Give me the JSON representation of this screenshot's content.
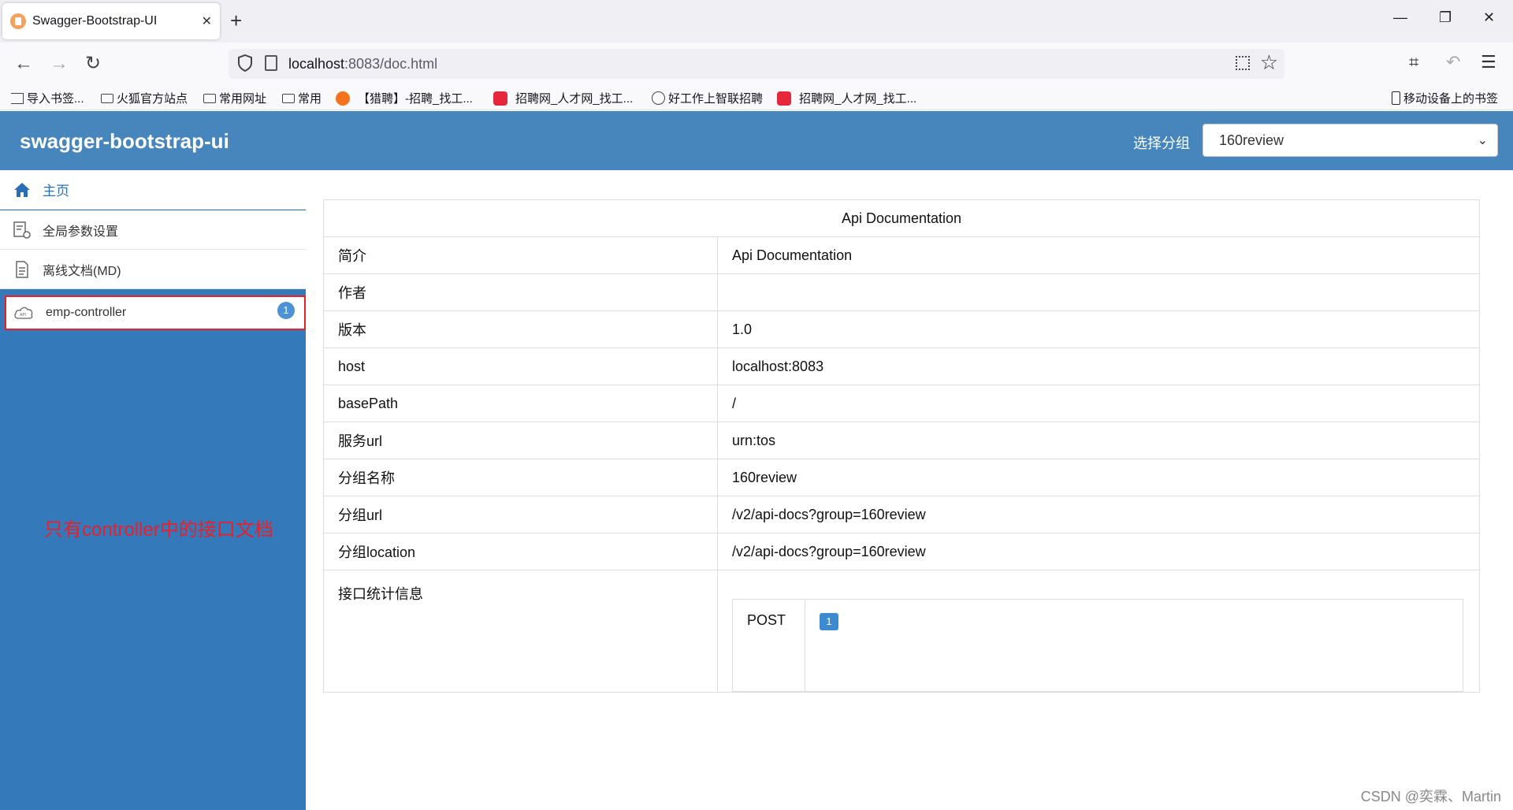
{
  "browser": {
    "tab_title": "Swagger-Bootstrap-UI",
    "new_tab": "+",
    "url_host": "localhost",
    "url_rest": ":8083/doc.html",
    "bookmarks": [
      {
        "label": "导入书签...",
        "icon": "import-icon"
      },
      {
        "label": "火狐官方站点",
        "icon": "folder-icon"
      },
      {
        "label": "常用网址",
        "icon": "folder-icon"
      },
      {
        "label": "常用",
        "icon": "folder-icon"
      },
      {
        "label": "【猎聘】-招聘_找工...",
        "icon": "liepin-icon"
      },
      {
        "label": "招聘网_人才网_找工...",
        "icon": "zhaopin-icon"
      },
      {
        "label": "好工作上智联招聘",
        "icon": "globe-icon"
      },
      {
        "label": "招聘网_人才网_找工...",
        "icon": "zhaopin-icon"
      }
    ],
    "mobile_bookmarks": "移动设备上的书签"
  },
  "header": {
    "brand": "swagger-bootstrap-ui",
    "group_label": "选择分组",
    "group_value": "160review"
  },
  "sidebar": {
    "items": [
      {
        "label": "主页",
        "icon": "home-icon"
      },
      {
        "label": "全局参数设置",
        "icon": "settings-doc-icon"
      },
      {
        "label": "离线文档(MD)",
        "icon": "document-icon"
      },
      {
        "label": "emp-controller",
        "icon": "api-cloud-icon",
        "badge": "1"
      }
    ],
    "note": "只有controller中的接口文档"
  },
  "doc": {
    "title": "Api Documentation",
    "rows": [
      {
        "key": "简介",
        "value": "Api Documentation"
      },
      {
        "key": "作者",
        "value": ""
      },
      {
        "key": "版本",
        "value": "1.0"
      },
      {
        "key": "host",
        "value": "localhost:8083"
      },
      {
        "key": "basePath",
        "value": "/"
      },
      {
        "key": "服务url",
        "value": "urn:tos"
      },
      {
        "key": "分组名称",
        "value": "160review"
      },
      {
        "key": "分组url",
        "value": "/v2/api-docs?group=160review"
      },
      {
        "key": "分组location",
        "value": "/v2/api-docs?group=160review"
      }
    ],
    "stats_label": "接口统计信息",
    "stats": [
      {
        "method": "POST",
        "count": "1"
      }
    ]
  },
  "watermark": "CSDN @奕霖、Martin",
  "colors": {
    "header": "#4786bd",
    "sidebar": "#3479b9",
    "highlight": "#e8202a",
    "badge": "#3c8ad0"
  }
}
